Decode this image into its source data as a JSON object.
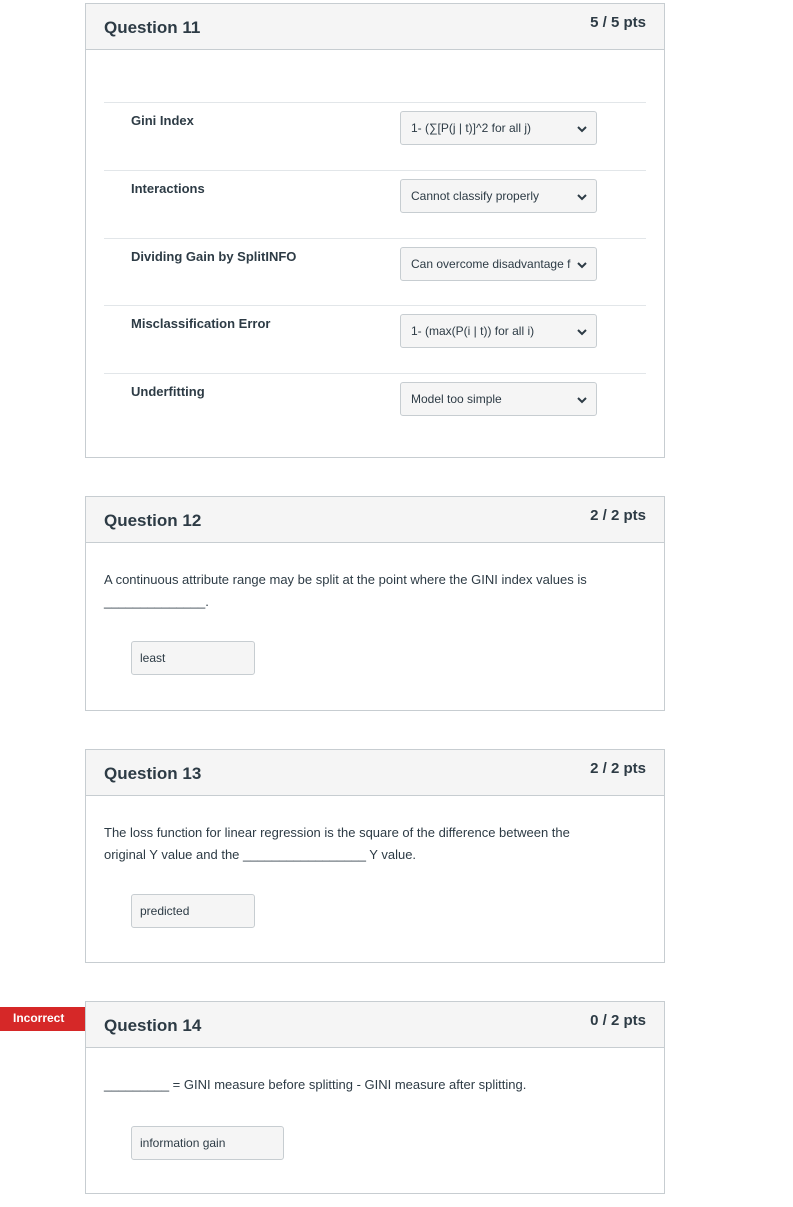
{
  "q11": {
    "title": "Question 11",
    "points": "5 / 5 pts",
    "rows": [
      {
        "label": "Gini Index",
        "selected": "1- (∑[P(j | t)]^2 for all j)"
      },
      {
        "label": "Interactions",
        "selected": "Cannot classify properly"
      },
      {
        "label": "Dividing Gain by SplitINFO",
        "selected": "Can overcome disadvantage f"
      },
      {
        "label": "Misclassification Error",
        "selected": "1- (max(P(i | t)) for all i)"
      },
      {
        "label": "Underfitting",
        "selected": "Model too simple"
      }
    ]
  },
  "q12": {
    "title": "Question 12",
    "points": "2 / 2 pts",
    "text_line1": "A continuous attribute range may be split at the point where the GINI index values is",
    "text_line2": "______________.",
    "answer": "least"
  },
  "q13": {
    "title": "Question 13",
    "points": "2 / 2 pts",
    "text_line1": "The loss function for linear regression is the square of the difference between the",
    "text_line2": "original Y value and the _________________ Y value.",
    "answer": "predicted"
  },
  "q14": {
    "status": "Incorrect",
    "title": "Question 14",
    "points": "0 / 2 pts",
    "text_line1": "_________  = GINI measure before splitting -  GINI measure  after  splitting.",
    "answer": "information gain"
  },
  "colors": {
    "incorrect_flag": "#d62828",
    "header_bg": "#f5f5f5",
    "border": "#c7cdd1"
  }
}
